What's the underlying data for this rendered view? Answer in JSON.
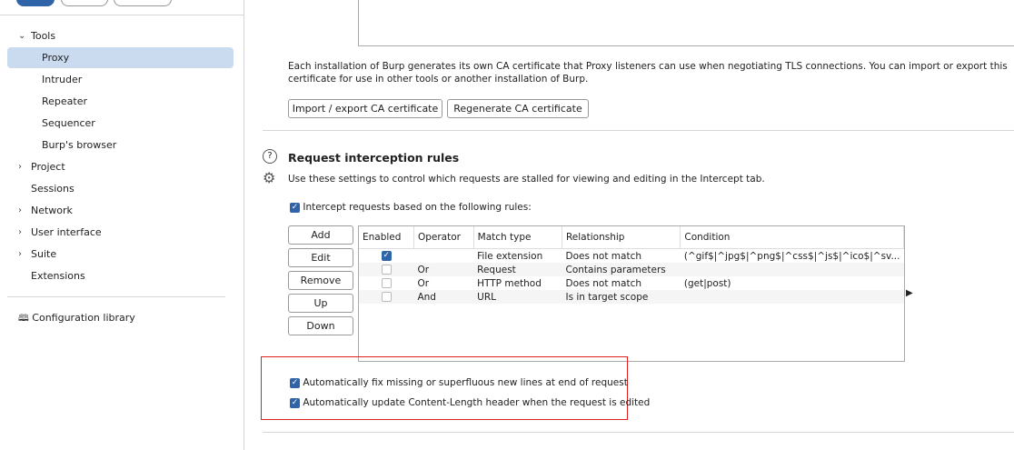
{
  "sidebar": {
    "items": [
      {
        "label": "Tools",
        "chevron": "down"
      },
      {
        "label": "Proxy",
        "selected": true
      },
      {
        "label": "Intruder"
      },
      {
        "label": "Repeater"
      },
      {
        "label": "Sequencer"
      },
      {
        "label": "Burp's browser"
      },
      {
        "label": "Project",
        "chevron": "right"
      },
      {
        "label": "Sessions"
      },
      {
        "label": "Network",
        "chevron": "right"
      },
      {
        "label": "User interface",
        "chevron": "right"
      },
      {
        "label": "Suite",
        "chevron": "right"
      },
      {
        "label": "Extensions"
      }
    ],
    "config_library": "Configuration library"
  },
  "ca": {
    "description": "Each installation of Burp generates its own CA certificate that Proxy listeners can use when negotiating TLS connections. You can import or export this certificate for use in other tools or another installation of Burp.",
    "import_label": "Import / export CA certificate",
    "regen_label": "Regenerate CA certificate"
  },
  "rules": {
    "title": "Request interception rules",
    "description": "Use these settings to control which requests are stalled for viewing and editing in the Intercept tab.",
    "intercept_label": "Intercept requests based on the following rules:",
    "buttons": {
      "add": "Add",
      "edit": "Edit",
      "remove": "Remove",
      "up": "Up",
      "down": "Down"
    },
    "columns": [
      "Enabled",
      "Operator",
      "Match type",
      "Relationship",
      "Condition"
    ],
    "rows": [
      {
        "enabled": true,
        "operator": "",
        "match": "File extension",
        "rel": "Does not match",
        "cond": "(^gif$|^jpg$|^png$|^css$|^js$|^ico$|^sv..."
      },
      {
        "enabled": false,
        "operator": "Or",
        "match": "Request",
        "rel": "Contains parameters",
        "cond": ""
      },
      {
        "enabled": false,
        "operator": "Or",
        "match": "HTTP method",
        "rel": "Does not match",
        "cond": "(get|post)"
      },
      {
        "enabled": false,
        "operator": "And",
        "match": "URL",
        "rel": "Is in target scope",
        "cond": ""
      }
    ],
    "fix_newlines": "Automatically fix missing or superfluous new lines at end of request",
    "update_length": "Automatically update Content-Length header when the request is edited"
  },
  "colors": {
    "accent": "#2f64a8",
    "selected": "#cadbf0",
    "highlight": "#e02020"
  }
}
